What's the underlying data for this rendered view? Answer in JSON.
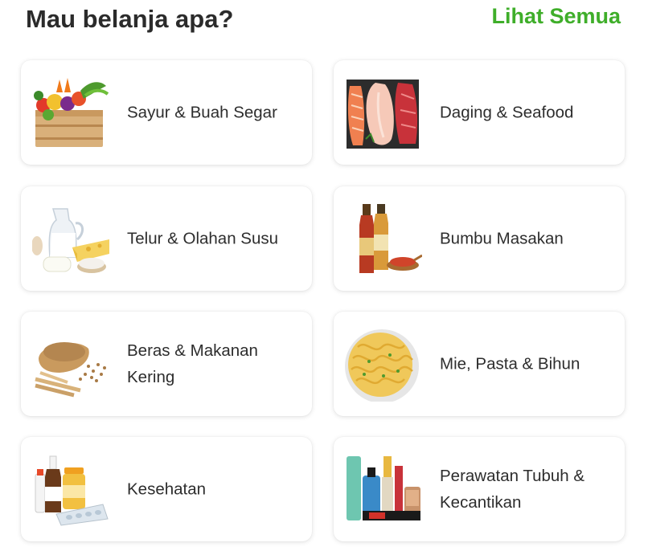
{
  "header": {
    "title": "Mau belanja apa?",
    "see_all_label": "Lihat Semua"
  },
  "categories": [
    {
      "label": "Sayur & Buah Segar",
      "icon": "vegetable-crate-icon"
    },
    {
      "label": "Daging & Seafood",
      "icon": "meat-fish-icon"
    },
    {
      "label": "Telur & Olahan Susu",
      "icon": "dairy-eggs-icon"
    },
    {
      "label": "Bumbu Masakan",
      "icon": "sauce-bottles-icon"
    },
    {
      "label": "Beras & Makanan Kering",
      "icon": "grain-wheat-icon"
    },
    {
      "label": "Mie, Pasta & Bihun",
      "icon": "noodle-bowl-icon"
    },
    {
      "label": "Kesehatan",
      "icon": "medicine-icon"
    },
    {
      "label": "Perawatan Tubuh & Kecantikan",
      "icon": "cosmetics-icon"
    }
  ],
  "colors": {
    "accent": "#3fae2a",
    "title": "#2b2b2b",
    "card_text": "#2d2d2d"
  }
}
